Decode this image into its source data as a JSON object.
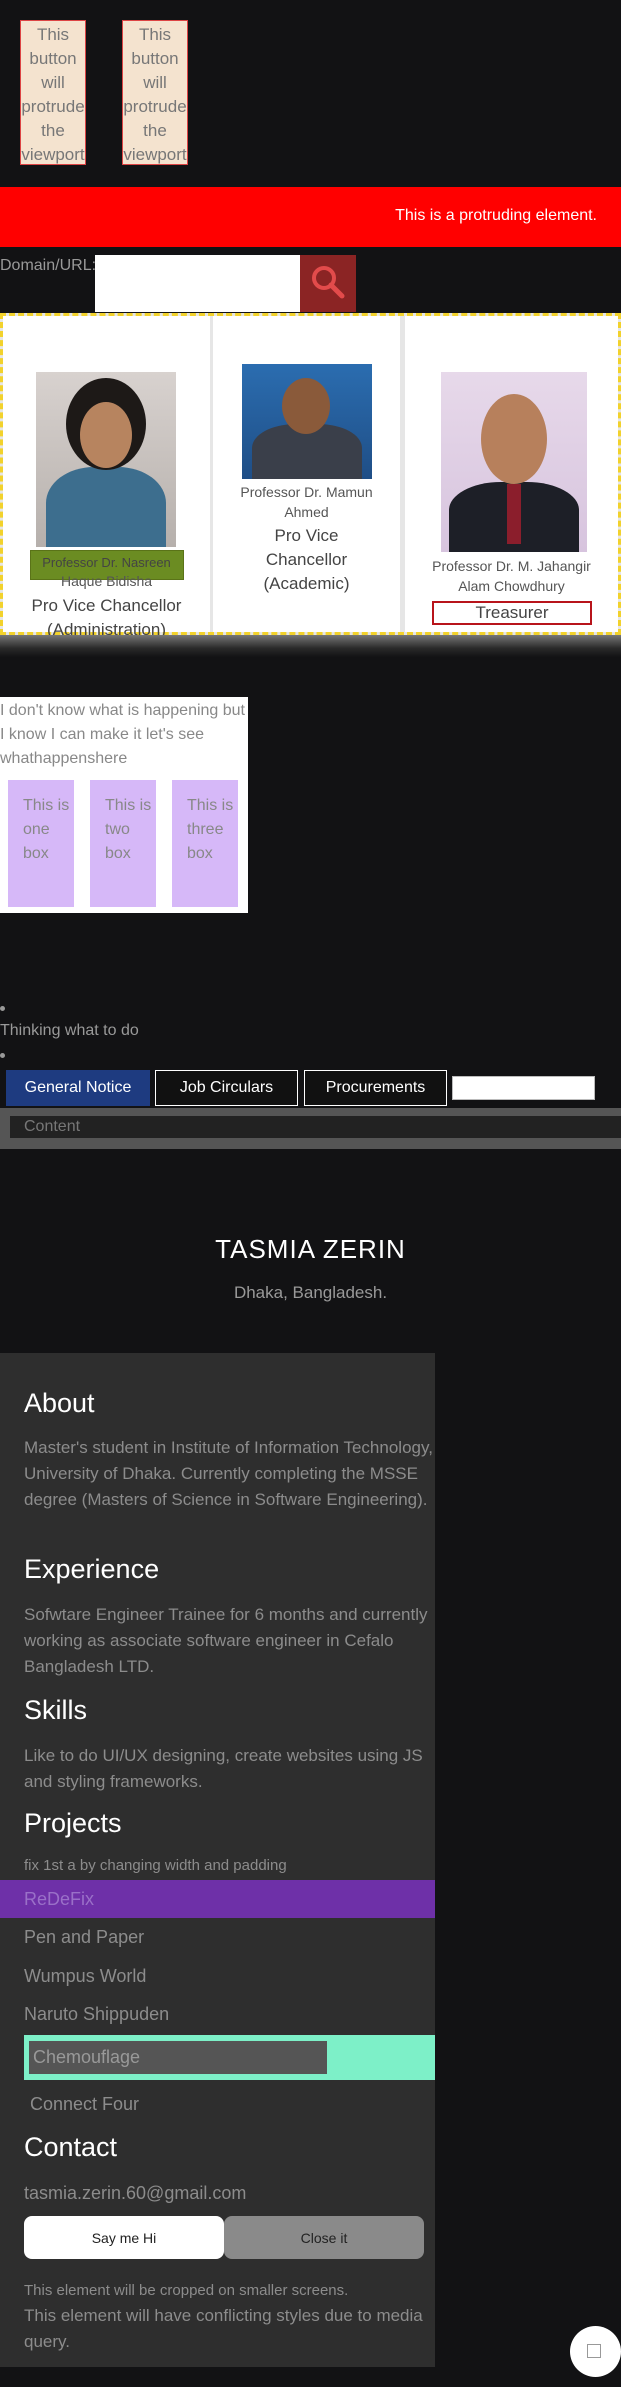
{
  "protrude_buttons": {
    "left_label": "This button will protrude the viewport",
    "right_label": "This button will protrude the viewport"
  },
  "red_bar": {
    "text": "This is a protruding element."
  },
  "domain": {
    "label": "Domain/URL:",
    "value": "",
    "search_icon": "search-icon"
  },
  "cards": [
    {
      "highlight": "Professor Dr. Nasreen",
      "name_tail": "Haque Bidisha",
      "role": "Pro Vice Chancellor (Administration)",
      "accent": "#6b8c22"
    },
    {
      "name": "Professor Dr. Mamun Ahmed",
      "role": "Pro Vice Chancellor (Academic)"
    },
    {
      "name": "Professor Dr. M. Jahangir Alam Chowdhury",
      "role": "Treasurer",
      "accent": "#b8141b"
    }
  ],
  "box_panel": {
    "text": "I don't know what is happening but I know I can make it let's see whathappenshere",
    "boxes": [
      "This is one box",
      "This is two box",
      "This is three box"
    ]
  },
  "thinking": "Thinking what to do",
  "tabs": {
    "items": [
      "General Notice",
      "Job Circulars",
      "Procurements"
    ],
    "active": "General Notice",
    "search_value": ""
  },
  "content_label": "Content",
  "hero": {
    "name": "TASMIA ZERIN",
    "location": "Dhaka, Bangladesh."
  },
  "resume": {
    "about_title": "About",
    "about_text": "Master's student in Institute of Information Technology, University of Dhaka. Currently completing the MSSE degree (Masters of Science in Software Engineering).",
    "experience_title": "Experience",
    "experience_text": "Sofwtare Engineer Trainee for 6 months and currently working as associate software engineer in Cefalo Bangladesh LTD.",
    "skills_title": "Skills",
    "skills_text": "Like to do UI/UX designing, create websites using JS and styling frameworks.",
    "projects_title": "Projects",
    "projects_note": "fix 1st a by changing width and padding",
    "projects": [
      "ReDeFix",
      "Pen and Paper",
      "Wumpus World",
      "Naruto Shippuden",
      "Chemouflage",
      "Connect Four"
    ],
    "contact_title": "Contact",
    "email": "tasmia.zerin.60@gmail.com",
    "say_hi": "Say me Hi",
    "close": "Close it",
    "crop_note": "This element will be cropped on smaller screens.",
    "conflict_note": "This element will have conflicting styles due to media query."
  },
  "colors": {
    "background": "#121214",
    "protruding_bar": "#ff0000",
    "tab_active": "#1e3b80",
    "redefix": "#6e30a8",
    "chemouflage": "#7df0c8"
  }
}
